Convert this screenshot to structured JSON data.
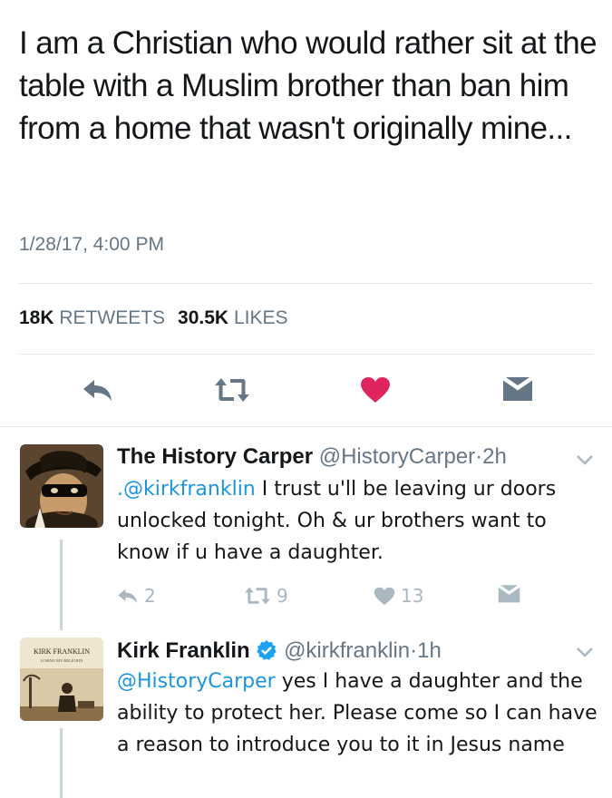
{
  "main_tweet": {
    "text": "I am a Christian who would rather sit at the table with a Muslim brother than ban him from a home that wasn't originally mine...",
    "timestamp": "1/28/17, 4:00 PM",
    "retweets_count": "18K",
    "retweets_label": "RETWEETS",
    "likes_count": "30.5K",
    "likes_label": "LIKES",
    "actions": {
      "reply_icon": "reply-icon",
      "retweet_icon": "retweet-icon",
      "like_icon": "heart-icon",
      "dm_icon": "envelope-icon"
    },
    "like_color": "#e0245e"
  },
  "replies": [
    {
      "name": "The History Carper",
      "handle": "@HistoryCarper",
      "separator": "·",
      "time": "2h",
      "text_mention": ".@kirkfranklin",
      "text_body": " I trust u'll be leaving ur doors unlocked tonight. Oh & ur brothers want to know if u have a daughter.",
      "reply_count": "2",
      "retweet_count": "9",
      "like_count": "13"
    },
    {
      "name": "Kirk Franklin",
      "verified": true,
      "handle": "@kirkfranklin",
      "separator": "·",
      "time": "1h",
      "avatar_title": "KIRK FRANKLIN",
      "avatar_subtitle": "LOSING MY RELIGION",
      "text_mention": "@HistoryCarper",
      "text_body": " yes I have a daughter and the ability to protect her. Please come so I can have a reason to introduce you to it in Jesus name"
    }
  ],
  "colors": {
    "text": "#14171a",
    "muted": "#657786",
    "link": "#1b95e0",
    "icon": "#657786",
    "icon_light": "#aab8c2",
    "divider": "#e1e8ed",
    "verified": "#1da1f2"
  }
}
